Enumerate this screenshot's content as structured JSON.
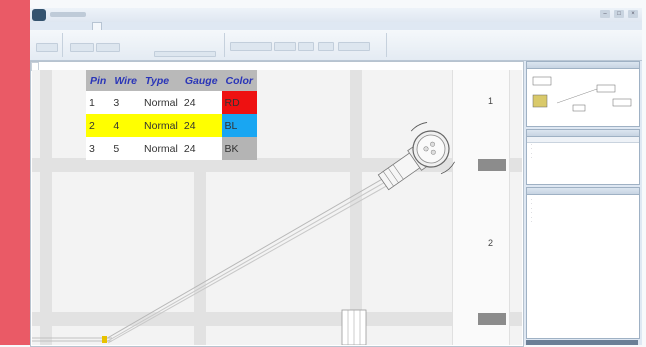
{
  "window": {
    "title": "",
    "tabs": [
      "",
      "",
      "",
      "",
      ""
    ]
  },
  "ribbon": {
    "group1_label": "",
    "group2_label": "",
    "group3_label": ""
  },
  "document_tab": "",
  "wire_table": {
    "headers": [
      "Pin",
      "Wire",
      "Type",
      "Gauge",
      "Color"
    ],
    "rows": [
      {
        "pin": "1",
        "wire": "3",
        "type": "Normal",
        "gauge": "24",
        "color": "RD"
      },
      {
        "pin": "2",
        "wire": "4",
        "type": "Normal",
        "gauge": "24",
        "color": "BL"
      },
      {
        "pin": "3",
        "wire": "5",
        "type": "Normal",
        "gauge": "24",
        "color": "BK"
      }
    ]
  },
  "connector_labels": {
    "top": "1",
    "bottom": "2"
  },
  "colors": {
    "accent_bar": "#ea5a66",
    "header_text": "#2a35b8",
    "highlight_row": "#ffff00",
    "wire_rd": "#ee1111",
    "wire_bl": "#19a6f2",
    "wire_bk": "#b4b4b4"
  },
  "icons": {
    "app_menu": "app-orb-icon",
    "connector": "circular-connector-icon",
    "minimize": "minimize-icon",
    "maximize": "maximize-icon",
    "close": "close-icon"
  }
}
